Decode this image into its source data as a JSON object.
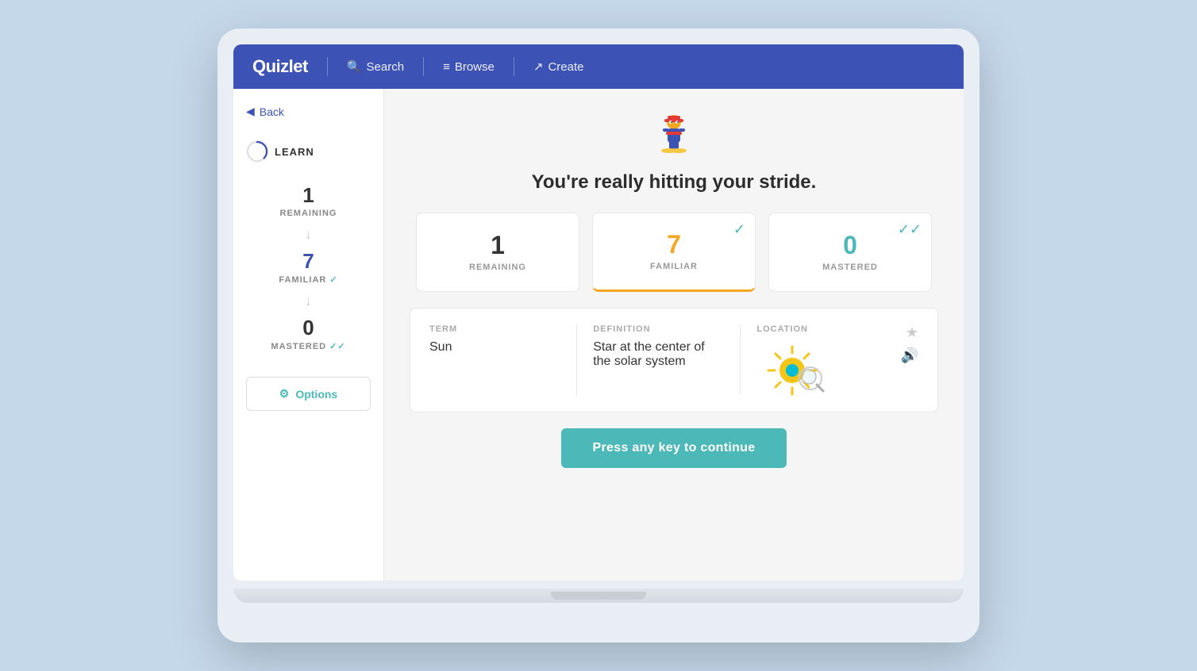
{
  "navbar": {
    "logo": "Quizlet",
    "search_label": "Search",
    "browse_label": "Browse",
    "create_label": "Create"
  },
  "sidebar": {
    "back_label": "Back",
    "learn_label": "LEARN",
    "remaining_count": "1",
    "remaining_label": "REMAINING",
    "familiar_count": "7",
    "familiar_label": "FAMILIAR",
    "mastered_count": "0",
    "mastered_label": "MASTERED",
    "options_label": "Options"
  },
  "main": {
    "headline": "You're really hitting your stride.",
    "stats": {
      "remaining": {
        "number": "1",
        "label": "REMAINING"
      },
      "familiar": {
        "number": "7",
        "label": "FAMILIAR"
      },
      "mastered": {
        "number": "0",
        "label": "MASTERED"
      }
    },
    "term_card": {
      "term_label": "TERM",
      "term_value": "Sun",
      "definition_label": "DEFINITION",
      "definition_value": "Star at the center of the solar system",
      "location_label": "LOCATION"
    },
    "continue_btn": "Press any key to continue"
  }
}
